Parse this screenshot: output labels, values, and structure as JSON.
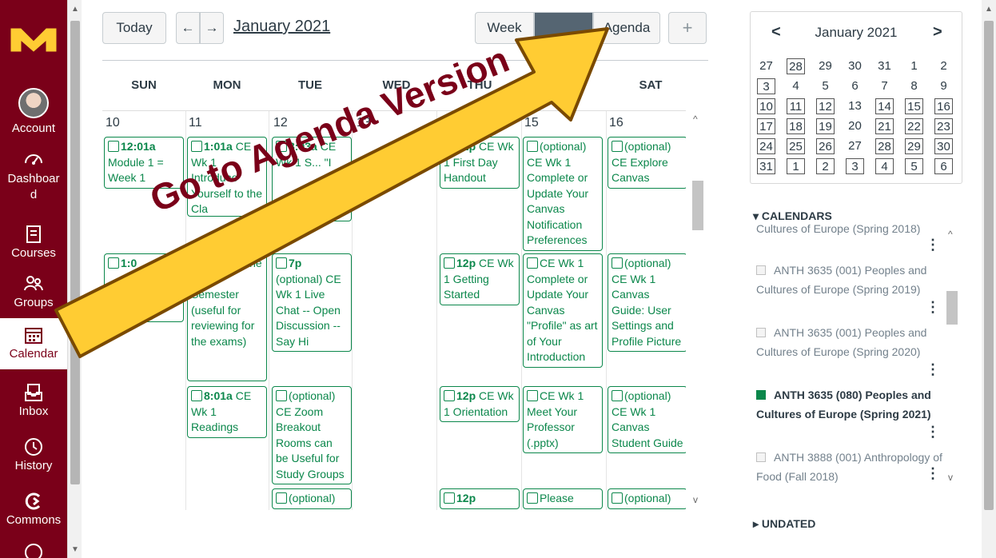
{
  "nav": {
    "account": "Account",
    "dashboard": "Dashboar d",
    "courses": "Courses",
    "groups": "Groups",
    "calendar": "Calendar",
    "inbox": "Inbox",
    "history": "History",
    "commons": "Commons"
  },
  "toolbar": {
    "today": "Today",
    "prev": "←",
    "next": "→",
    "month": "January 2021",
    "week": "Week",
    "agenda": "Agenda",
    "add": "+"
  },
  "week_days": [
    "SUN",
    "MON",
    "TUE",
    "WED",
    "THU",
    "FRI",
    "SAT"
  ],
  "day_numbers": [
    "10",
    "11",
    "12",
    "13",
    "14",
    "15",
    "16"
  ],
  "events": [
    {
      "time": "12:01a",
      "title": "Module 1 = Week 1"
    },
    {
      "time": "1:01a",
      "title": "CE Wk 1 Introduce Yourself to the Cla"
    },
    {
      "time": "8:03a",
      "title": "CE Wk 1 S... \"I"
    },
    {
      "time": "12p",
      "title": "CE Wk 1 First Day Handout"
    },
    {
      "time": "",
      "title": "(optional) CE Wk 1 Complete or Update Your Canvas Notification Preferences"
    },
    {
      "time": "",
      "title": "(optional) CE Explore Canvas"
    },
    {
      "time": "1:0",
      "title": ""
    },
    {
      "time": "",
      "title": "...dings for the Entire Semester (useful for reviewing for the exams)"
    },
    {
      "time": "7p",
      "title": "(optional) CE Wk 1 Live Chat -- Open Discussion -- Say Hi"
    },
    {
      "time": "12p",
      "title": "CE Wk 1 Getting Started"
    },
    {
      "time": "",
      "title": "CE Wk 1 Complete or Update Your Canvas \"Profile\" as art of Your Introduction"
    },
    {
      "time": "",
      "title": "(optional) CE Wk 1 Canvas Guide: User Settings and Profile Picture"
    },
    {
      "time": "8:01a",
      "title": "CE Wk 1 Readings"
    },
    {
      "time": "",
      "title": "(optional) CE Zoom Breakout Rooms can be Useful for Study Groups"
    },
    {
      "time": "12p",
      "title": "CE Wk 1 Orientation"
    },
    {
      "time": "",
      "title": "CE Wk 1 Meet Your Professor (.pptx)"
    },
    {
      "time": "",
      "title": "(optional) CE Wk 1 Canvas Student Guide"
    },
    {
      "time": "",
      "title": "(optional)"
    },
    {
      "time": "12p",
      "title": ""
    },
    {
      "time": "",
      "title": "Please"
    },
    {
      "time": "",
      "title": "(optional)"
    }
  ],
  "mini_calendar": {
    "title": "January 2021",
    "prev": "<",
    "next": ">",
    "rows": [
      [
        "27",
        "28",
        "29",
        "30",
        "31",
        "1",
        "2"
      ],
      [
        "3",
        "4",
        "5",
        "6",
        "7",
        "8",
        "9"
      ],
      [
        "10",
        "11",
        "12",
        "13",
        "14",
        "15",
        "16"
      ],
      [
        "17",
        "18",
        "19",
        "20",
        "21",
        "22",
        "23"
      ],
      [
        "24",
        "25",
        "26",
        "27",
        "28",
        "29",
        "30"
      ],
      [
        "31",
        "1",
        "2",
        "3",
        "4",
        "5",
        "6"
      ]
    ]
  },
  "calendars": {
    "heading": "CALENDARS",
    "items": [
      {
        "label": "Cultures of Europe (Spring 2018)",
        "checked": false
      },
      {
        "label": "ANTH 3635 (001) Peoples and Cultures of Europe (Spring 2019)",
        "checked": false
      },
      {
        "label": "ANTH 3635 (001) Peoples and Cultures of Europe (Spring 2020)",
        "checked": false
      },
      {
        "label": "ANTH 3635 (080) Peoples and Cultures of Europe (Spring 2021)",
        "checked": true
      },
      {
        "label": "ANTH 3888 (001) Anthropology of Food (Fall 2018)",
        "checked": false
      }
    ],
    "undated": "UNDATED"
  },
  "overlay": {
    "text": "Go to Agenda Version"
  },
  "colors": {
    "maroon": "#7a0019",
    "gold": "#ffcc33",
    "event_green": "#0b874b",
    "text": "#2d3b45"
  }
}
